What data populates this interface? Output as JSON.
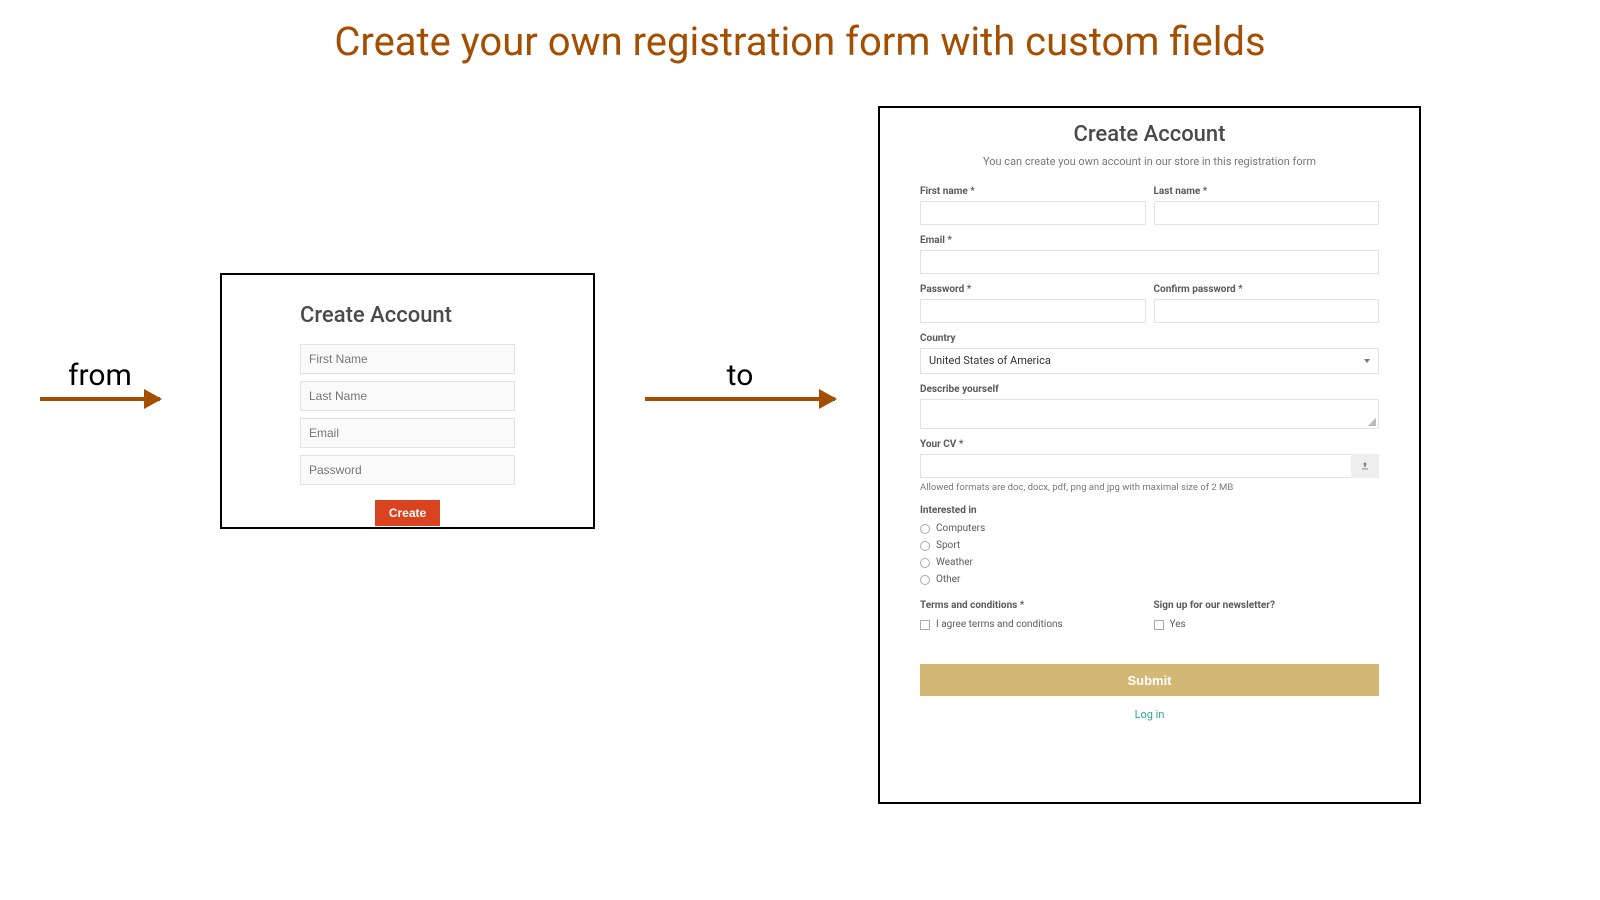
{
  "page_title": "Create your own registration form with custom fields",
  "arrows": {
    "from": "from",
    "to": "to"
  },
  "simple_form": {
    "title": "Create Account",
    "first_name_ph": "First Name",
    "last_name_ph": "Last Name",
    "email_ph": "Email",
    "password_ph": "Password",
    "submit": "Create"
  },
  "custom_form": {
    "title": "Create Account",
    "subtitle": "You can create you own account in our store in this registration form",
    "first_name_label": "First name *",
    "last_name_label": "Last name *",
    "email_label": "Email *",
    "password_label": "Password *",
    "confirm_password_label": "Confirm password *",
    "country_label": "Country",
    "country_value": "United States of America",
    "describe_label": "Describe yourself",
    "cv_label": "Your CV *",
    "cv_hint": "Allowed formats are doc, docx, pdf, png and jpg with maximal size of 2 MB",
    "interested_label": "Interested in",
    "interested_options": [
      "Computers",
      "Sport",
      "Weather",
      "Other"
    ],
    "terms_label": "Terms and conditions *",
    "terms_checkbox": "I agree terms and conditions",
    "newsletter_label": "Sign up for our newsletter?",
    "newsletter_checkbox": "Yes",
    "submit": "Submit",
    "login": "Log in"
  }
}
